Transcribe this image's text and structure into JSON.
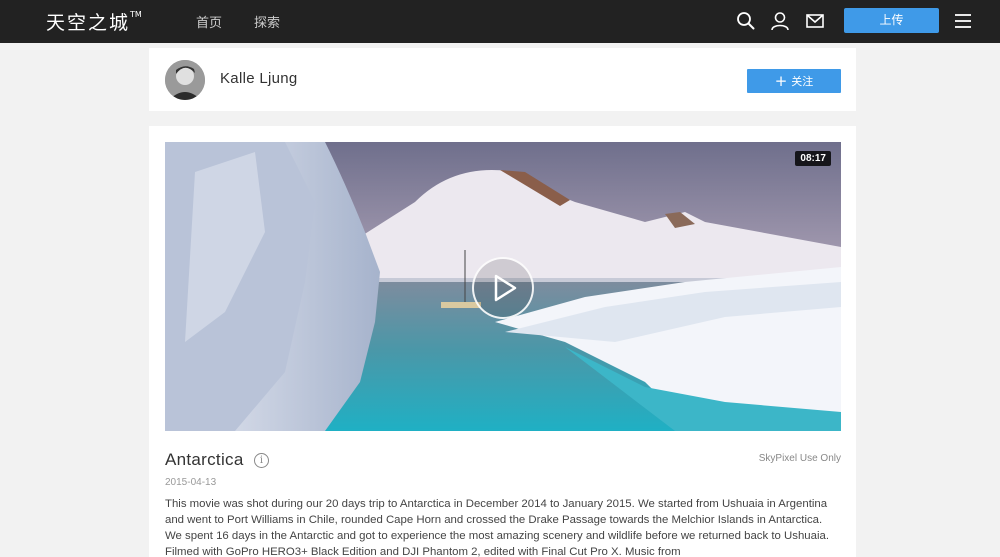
{
  "header": {
    "logo": "天空之城",
    "logo_tm": "TM",
    "nav": [
      "首页",
      "探索"
    ],
    "upload_label": "上传",
    "icons": [
      "search-icon",
      "user-icon",
      "mail-icon",
      "menu-icon"
    ]
  },
  "profile": {
    "username": "Kalle Ljung",
    "follow_plus": "+",
    "follow_label": "关注"
  },
  "video": {
    "duration": "08:17",
    "title": "Antarctica",
    "info_symbol": "i",
    "license": "SkyPixel Use Only",
    "date": "2015-04-13",
    "description": "This movie was shot during our 20 days trip to Antarctica in December 2014 to January 2015. We started from Ushuaia in Argentina and went to Port Williams in Chile, rounded Cape Horn and crossed the Drake Passage towards the Melchior Islands in Antarctica. We spent 16 days in the Antarctic and got to experience the most amazing scenery and wildlife before we returned back to Ushuaia. Filmed with GoPro HERO3+ Black Edition and DJI Phantom 2, edited with Final Cut Pro X. Music from"
  },
  "colors": {
    "topbar": "#222222",
    "accent": "#3f9ae8",
    "page_bg": "#f2f2f2"
  }
}
